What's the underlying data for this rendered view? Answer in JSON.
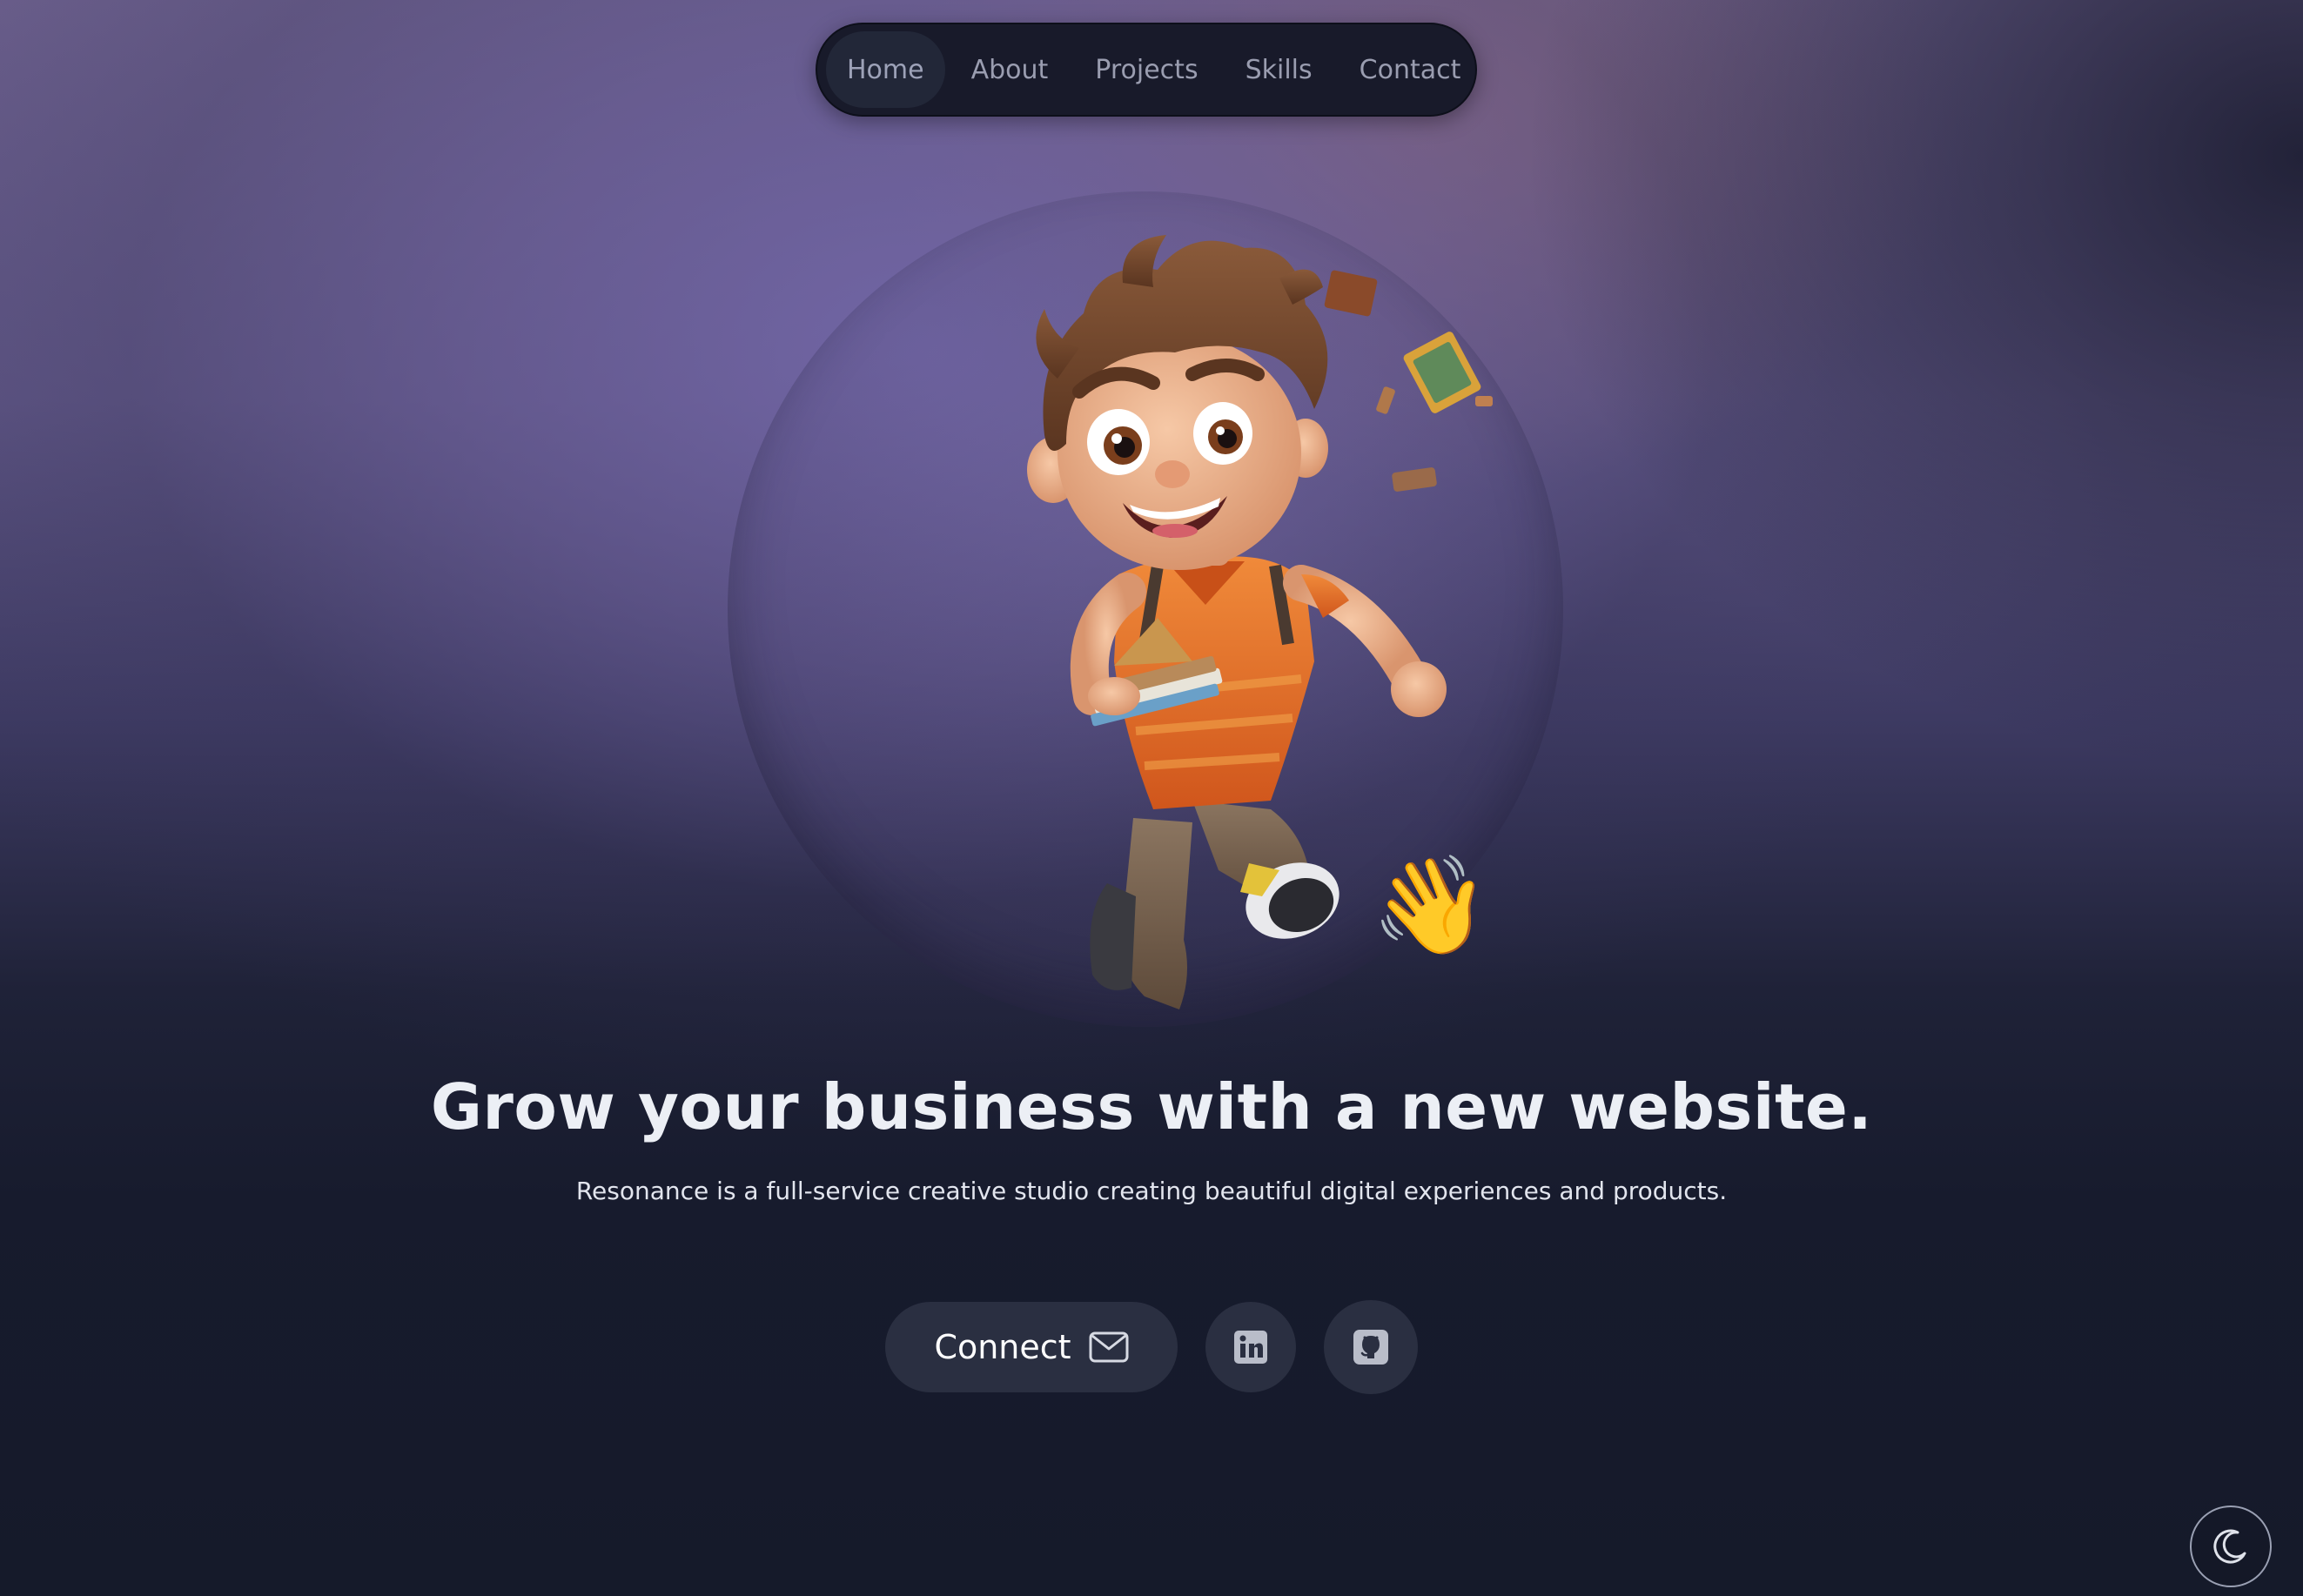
{
  "nav": {
    "items": [
      {
        "label": "Home",
        "active": true
      },
      {
        "label": "About",
        "active": false
      },
      {
        "label": "Projects",
        "active": false
      },
      {
        "label": "Skills",
        "active": false
      },
      {
        "label": "Contact",
        "active": false
      }
    ]
  },
  "hero": {
    "illustration": "running-cartoon-boy-with-books",
    "wave_emoji": "👋",
    "headline": "Grow your business with a new website.",
    "subline": "Resonance is a full-service creative studio creating beautiful digital experiences and products."
  },
  "actions": {
    "connect_label": "Connect",
    "connect_icon": "mail-icon",
    "social": [
      {
        "name": "linkedin-icon"
      },
      {
        "name": "github-icon"
      }
    ]
  },
  "theme_toggle": {
    "icon": "moon-icon"
  },
  "colors": {
    "background_top": "#6b5f8c",
    "background_bottom": "#151a2a",
    "nav_bg": "#181a2a",
    "button_bg": "#2a2f41",
    "text_primary": "#eceff5",
    "accent_orange": "#e8702a"
  }
}
